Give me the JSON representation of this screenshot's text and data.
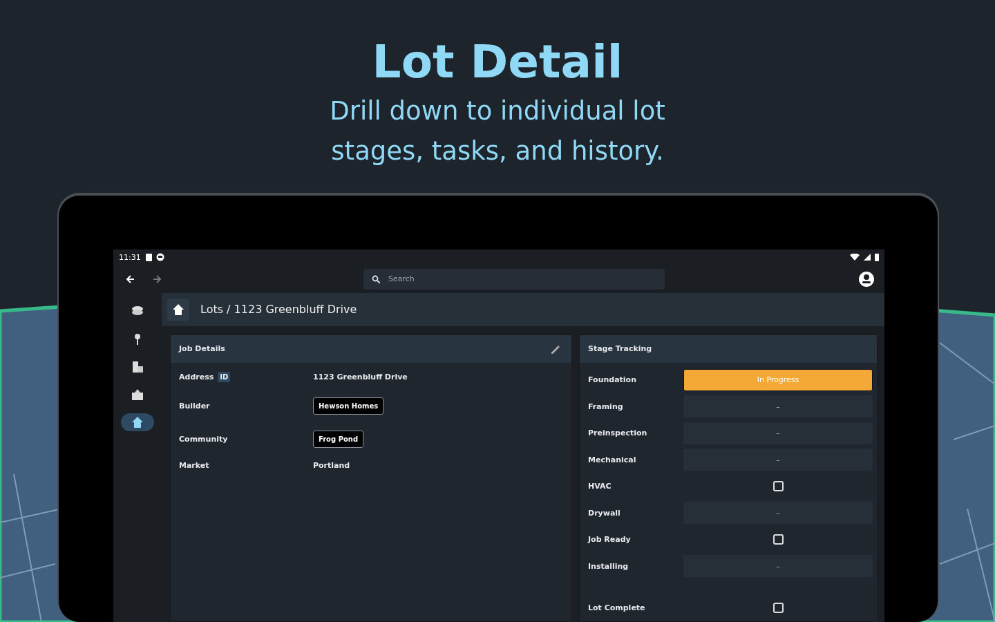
{
  "headline": {
    "title": "Lot Detail",
    "subtitle": "Drill down to individual lot stages, tasks, and history."
  },
  "status_bar": {
    "time": "11:31"
  },
  "search": {
    "placeholder": "Search"
  },
  "nav_rail": [
    {
      "selected": false
    },
    {
      "selected": false
    },
    {
      "selected": false
    },
    {
      "selected": false
    },
    {
      "selected": true
    }
  ],
  "breadcrumb": "Lots / 1123 Greenbluff Drive",
  "job_details": {
    "title": "Job Details",
    "fields": [
      {
        "label": "Address",
        "badge": "ID",
        "value": "1123 Greenbluff Drive",
        "kind": "text"
      },
      {
        "label": "Builder",
        "value": "Hewson Homes",
        "kind": "chip"
      },
      {
        "label": "Community",
        "value": "Frog Pond",
        "kind": "chip"
      },
      {
        "label": "Market",
        "value": "Portland",
        "kind": "text"
      }
    ]
  },
  "stage_tracking": {
    "title": "Stage Tracking",
    "stages": [
      {
        "name": "Foundation",
        "kind": "status",
        "value": "In Progress",
        "active": true
      },
      {
        "name": "Framing",
        "kind": "status",
        "value": "–",
        "active": false
      },
      {
        "name": "Preinspection",
        "kind": "status",
        "value": "–",
        "active": false
      },
      {
        "name": "Mechanical",
        "kind": "status",
        "value": "–",
        "active": false
      },
      {
        "name": "HVAC",
        "kind": "checkbox",
        "checked": false
      },
      {
        "name": "Drywall",
        "kind": "status",
        "value": "–",
        "active": false
      },
      {
        "name": "Job Ready",
        "kind": "checkbox",
        "checked": false
      },
      {
        "name": "Installing",
        "kind": "status",
        "value": "–",
        "active": false
      },
      {
        "name": "Lot Complete",
        "kind": "checkbox",
        "checked": false
      }
    ]
  }
}
